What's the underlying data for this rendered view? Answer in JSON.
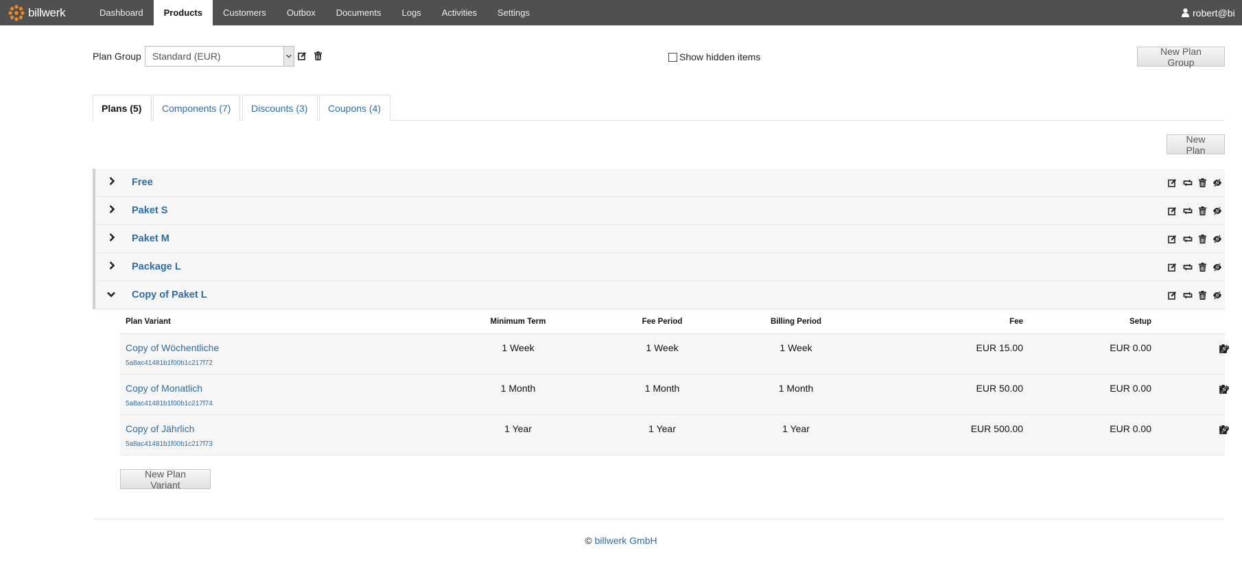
{
  "brand": {
    "name": "billwerk",
    "logo_icon": "billwerk-logo-icon",
    "logo_color": "#f08a24"
  },
  "nav": {
    "items": [
      {
        "label": "Dashboard",
        "active": false
      },
      {
        "label": "Products",
        "active": true
      },
      {
        "label": "Customers",
        "active": false
      },
      {
        "label": "Outbox",
        "active": false
      },
      {
        "label": "Documents",
        "active": false
      },
      {
        "label": "Logs",
        "active": false
      },
      {
        "label": "Activities",
        "active": false
      },
      {
        "label": "Settings",
        "active": false
      }
    ],
    "user": "robert@bi"
  },
  "plan_group": {
    "label": "Plan Group",
    "selected": "Standard (EUR)",
    "show_hidden_label": "Show hidden items",
    "show_hidden_checked": false,
    "new_group_label": "New Plan Group"
  },
  "tabs": [
    {
      "label": "Plans (5)",
      "active": true
    },
    {
      "label": "Components (7)",
      "active": false
    },
    {
      "label": "Discounts (3)",
      "active": false
    },
    {
      "label": "Coupons (4)",
      "active": false
    }
  ],
  "new_plan_label": "New Plan",
  "plans": [
    {
      "name": "Free",
      "expanded": false
    },
    {
      "name": "Paket S",
      "expanded": false
    },
    {
      "name": "Paket M",
      "expanded": false
    },
    {
      "name": "Package L",
      "expanded": false
    },
    {
      "name": "Copy of Paket L",
      "expanded": true
    }
  ],
  "variants": {
    "headers": {
      "plan_variant": "Plan Variant",
      "minimum_term": "Minimum Term",
      "fee_period": "Fee Period",
      "billing_period": "Billing Period",
      "fee": "Fee",
      "setup": "Setup"
    },
    "rows": [
      {
        "name": "Copy of Wöchentliche",
        "id": "5a8ac41481b1f00b1c217f72",
        "minimum_term": "1 Week",
        "fee_period": "1 Week",
        "billing_period": "1 Week",
        "fee": "EUR 15.00",
        "setup": "EUR 0.00"
      },
      {
        "name": "Copy of Monatlich",
        "id": "5a8ac41481b1f00b1c217f74",
        "minimum_term": "1 Month",
        "fee_period": "1 Month",
        "billing_period": "1 Month",
        "fee": "EUR 50.00",
        "setup": "EUR 0.00"
      },
      {
        "name": "Copy of Jährlich",
        "id": "5a8ac41481b1f00b1c217f73",
        "minimum_term": "1 Year",
        "fee_period": "1 Year",
        "billing_period": "1 Year",
        "fee": "EUR 500.00",
        "setup": "EUR 0.00"
      }
    ],
    "new_variant_label": "New Plan Variant"
  },
  "footer": {
    "copyright": "©",
    "company": "billwerk GmbH"
  }
}
